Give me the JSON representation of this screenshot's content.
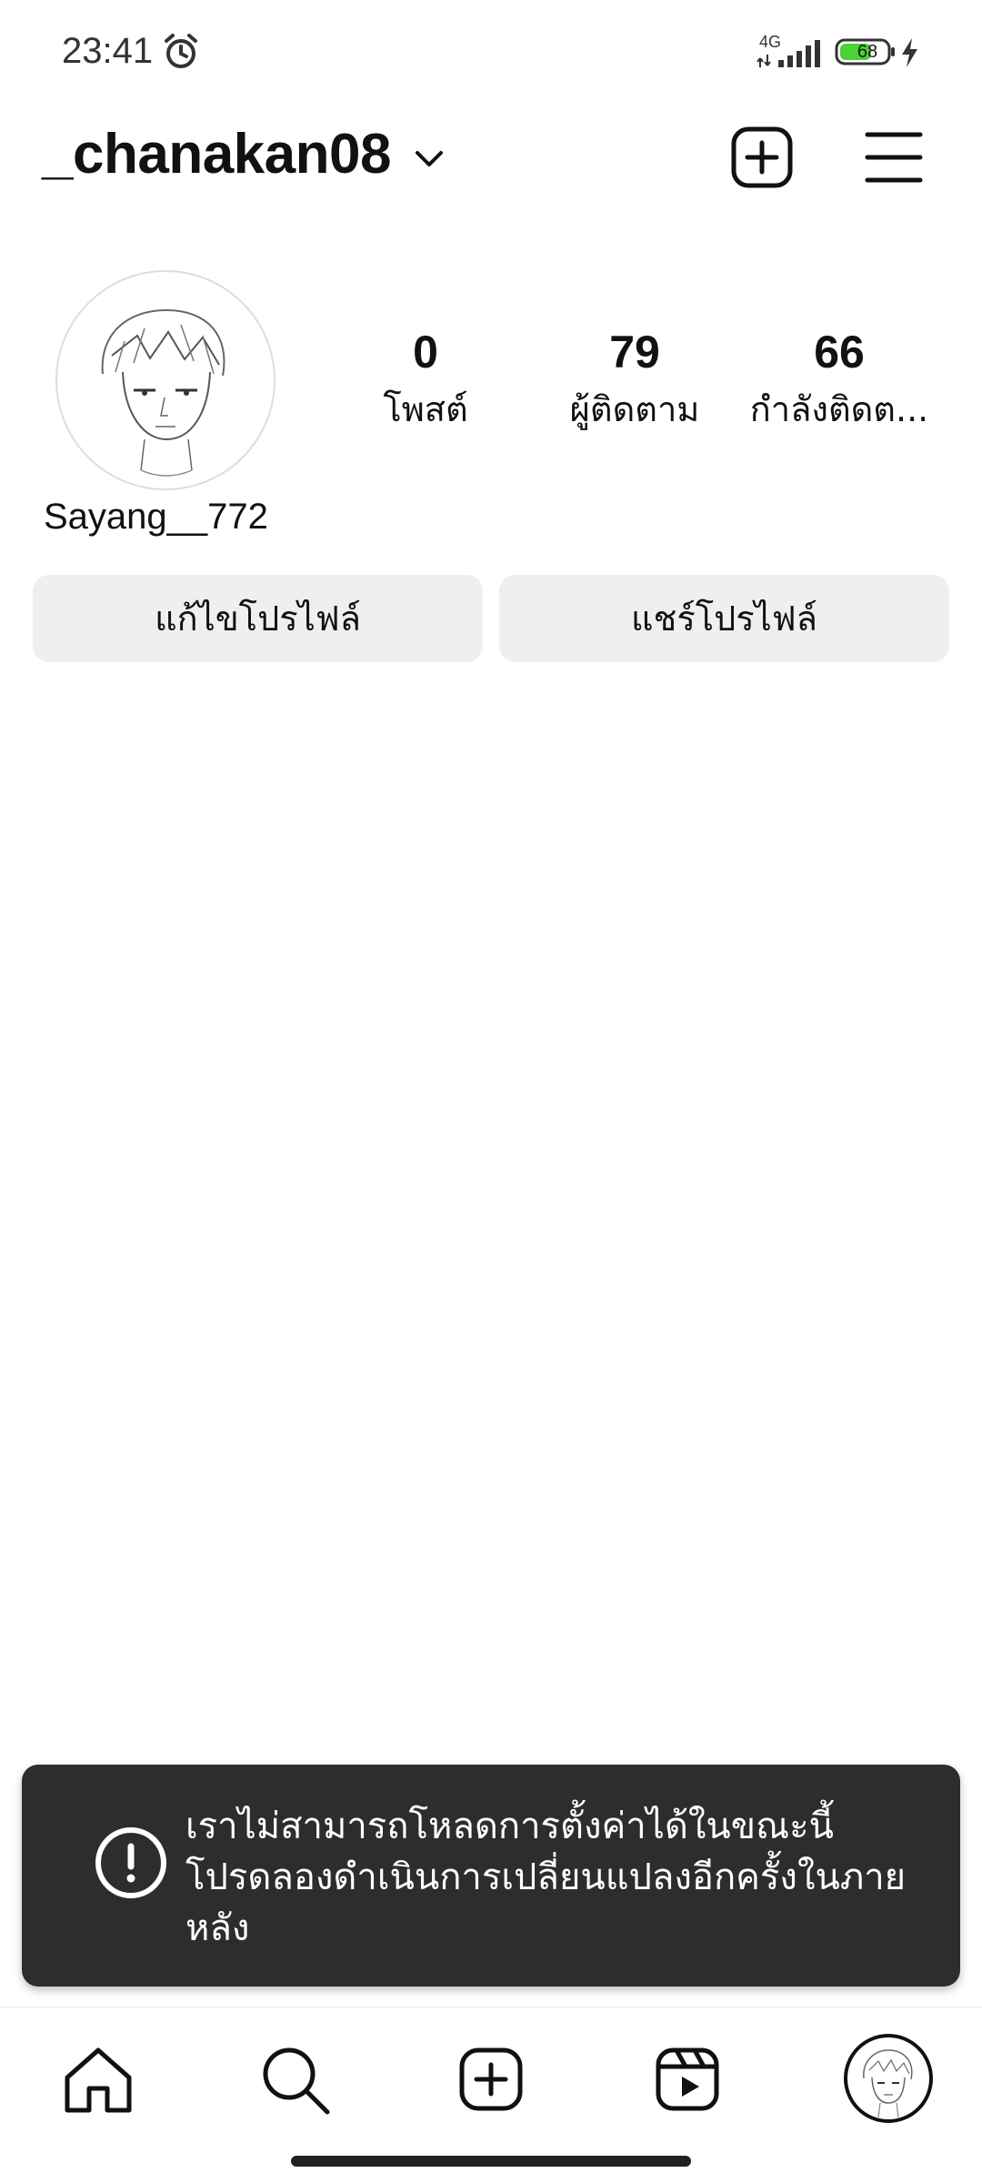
{
  "status_bar": {
    "time": "23:41",
    "network": "4G",
    "battery": "68",
    "battery_color": "#4cd137"
  },
  "header": {
    "username": "_chanakan08",
    "icons": [
      "chevron-down-icon",
      "add-post-icon",
      "menu-icon"
    ]
  },
  "profile": {
    "display_name": "Sayang__772",
    "stats": {
      "posts_value": "0",
      "posts_label": "โพสต์",
      "followers_value": "79",
      "followers_label": "ผู้ติดตาม",
      "following_value": "66",
      "following_label": "กำลังติดต..."
    },
    "buttons": {
      "edit_label": "แก้ไขโปรไฟล์",
      "share_label": "แชร์โปรไฟล์"
    }
  },
  "toast": {
    "icon": "info-icon",
    "line1": "เราไม่สามารถโหลดการตั้งค่าได้ในขณะนี้",
    "line2": "โปรดลองดำเนินการเปลี่ยนแปลงอีกครั้งในภาย",
    "line3": "หลัง"
  },
  "bottom_nav": {
    "items": [
      "home-icon",
      "search-icon",
      "create-icon",
      "reels-icon",
      "profile-avatar"
    ]
  }
}
